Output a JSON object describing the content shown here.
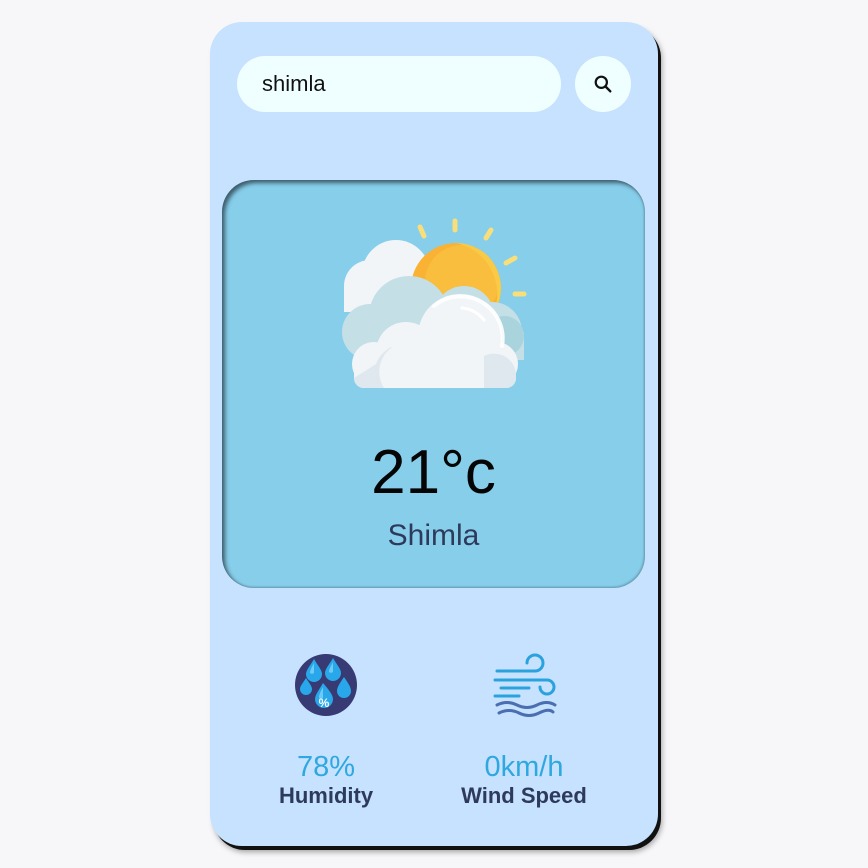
{
  "search": {
    "value": "shimla",
    "button_icon": "search-icon"
  },
  "weather": {
    "icon": "partly-cloudy-sun-icon",
    "temperature": "21°c",
    "city": "Shimla"
  },
  "stats": {
    "humidity": {
      "icon": "humidity-drops-icon",
      "value": "78%",
      "label": "Humidity"
    },
    "wind": {
      "icon": "wind-icon",
      "value": "0km/h",
      "label": "Wind Speed"
    }
  },
  "colors": {
    "card_background": "#c6e2fe",
    "panel_background": "#87ceeb",
    "input_background": "#efffff",
    "accent_value": "#2fa8df",
    "label_text": "#2e3a5c"
  }
}
